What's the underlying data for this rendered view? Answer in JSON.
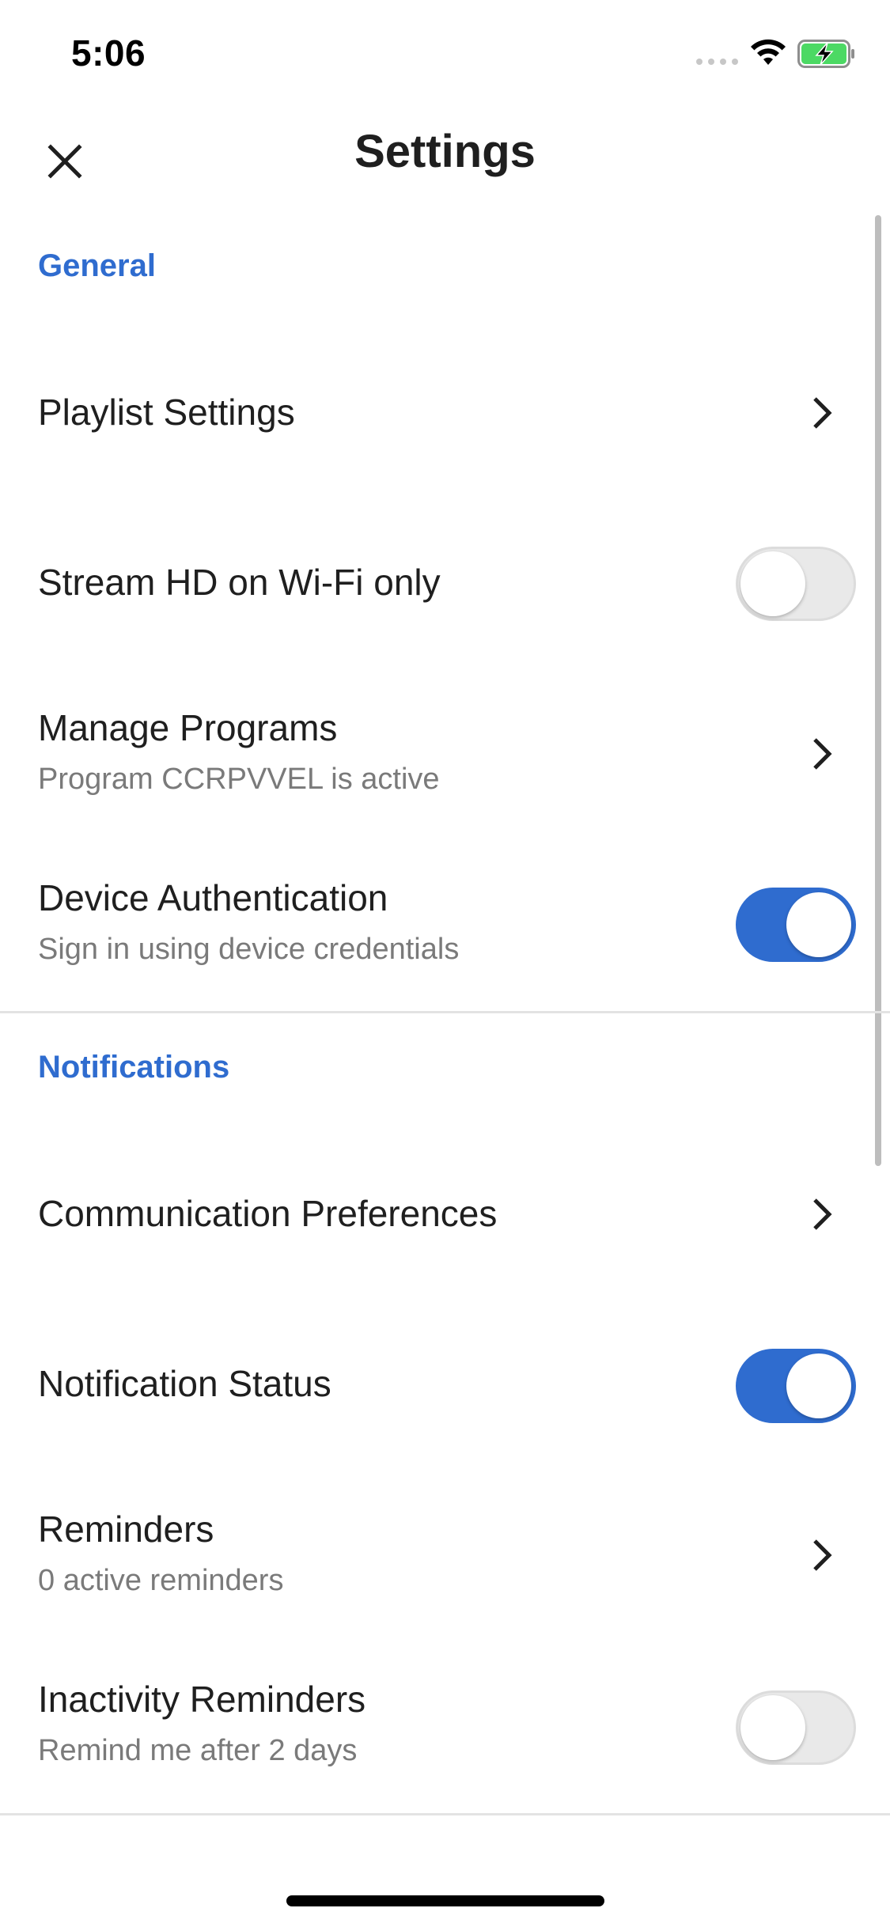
{
  "status_bar": {
    "time": "5:06"
  },
  "nav": {
    "title": "Settings",
    "close_icon": "close-icon"
  },
  "sections": {
    "general": {
      "header": "General",
      "playlist_settings": {
        "title": "Playlist Settings"
      },
      "stream_hd": {
        "title": "Stream HD on Wi-Fi only",
        "enabled": false
      },
      "manage_programs": {
        "title": "Manage Programs",
        "subtitle": "Program CCRPVVEL is active"
      },
      "device_auth": {
        "title": "Device Authentication",
        "subtitle": "Sign in using device credentials",
        "enabled": true
      }
    },
    "notifications": {
      "header": "Notifications",
      "communication_preferences": {
        "title": "Communication Preferences"
      },
      "notification_status": {
        "title": "Notification Status",
        "enabled": true
      },
      "reminders": {
        "title": "Reminders",
        "subtitle": "0 active reminders"
      },
      "inactivity_reminders": {
        "title": "Inactivity Reminders",
        "subtitle": "Remind me after 2 days",
        "enabled": false
      }
    }
  },
  "colors": {
    "accent": "#2f6ccf",
    "toggle_off": "#e9e9e9",
    "subtitle": "#7a7a7a",
    "divider": "#e3e3e3"
  }
}
